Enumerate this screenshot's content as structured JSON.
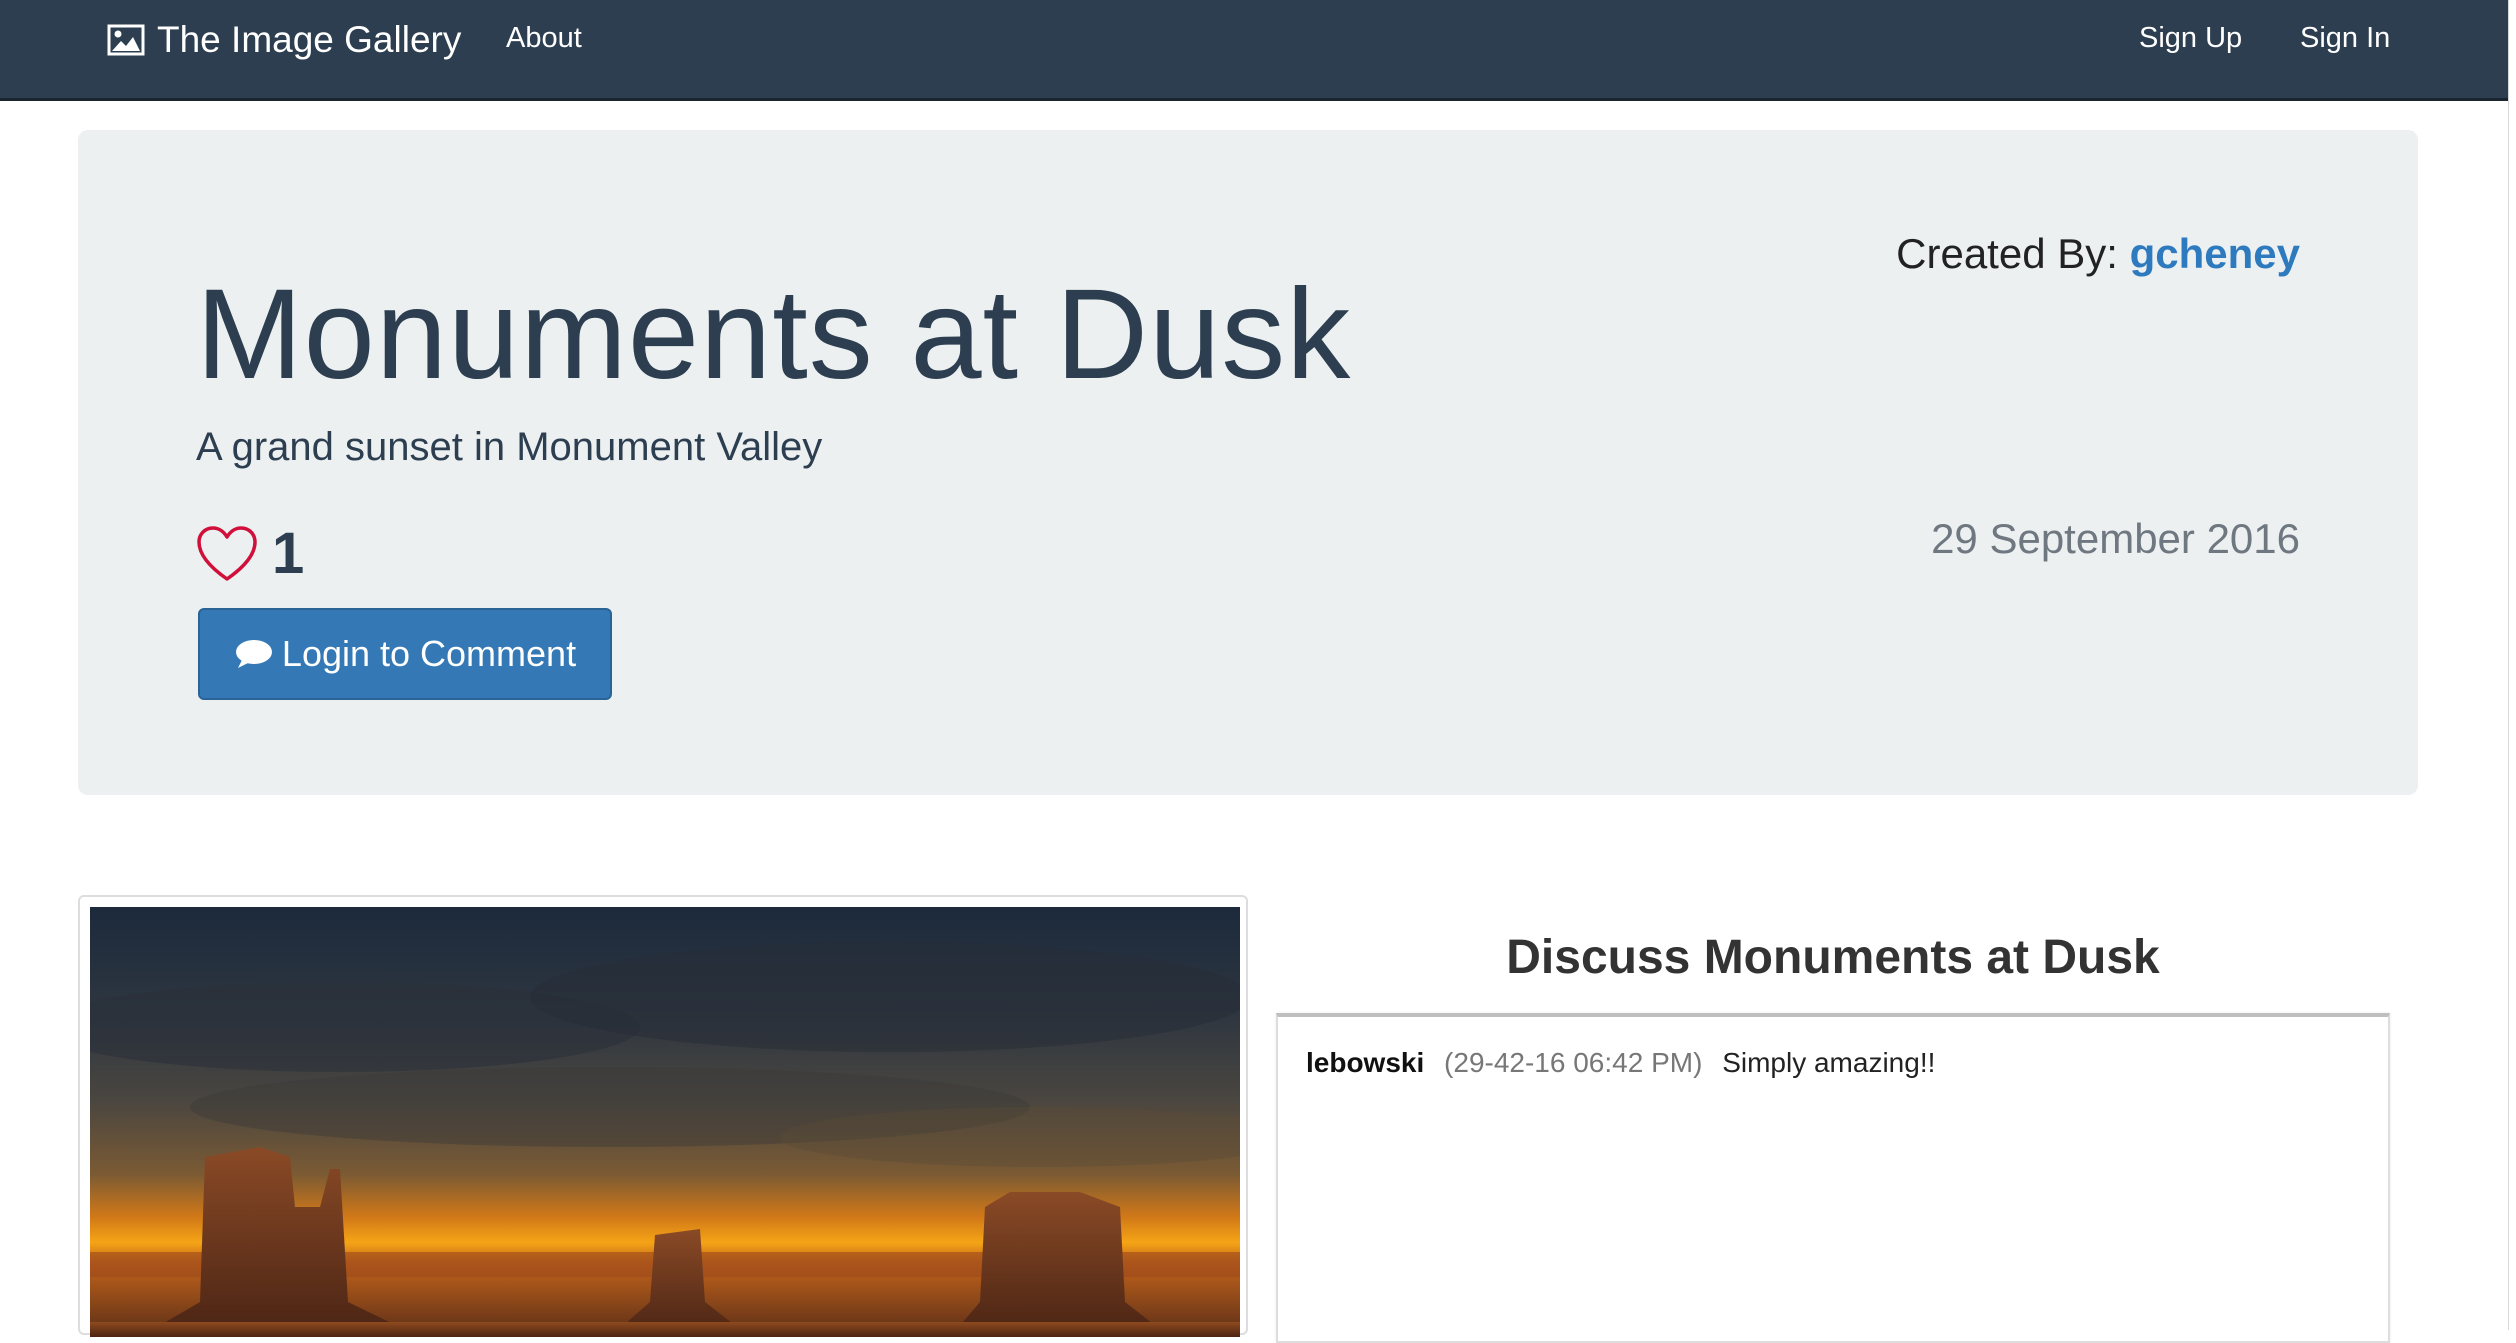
{
  "navbar": {
    "brand_icon": "image-icon",
    "brand": "The Image Gallery",
    "about": "About",
    "sign_up": "Sign Up",
    "sign_in": "Sign In",
    "background_color": "#2c3e50"
  },
  "jumbotron": {
    "title": "Monuments at Dusk",
    "subtitle": "A grand sunset in Monument Valley",
    "created_by_label": "Created By:",
    "created_by_user": "gcheney",
    "date": "29 September 2016",
    "like_icon": "heart-outline-icon",
    "like_color": "#d0103a",
    "likes": "1",
    "comment_button_icon": "comment-icon",
    "comment_button": "Login to Comment",
    "button_color": "#3479b5"
  },
  "image": {
    "content": "photo-monument-valley-sunset"
  },
  "discussion": {
    "title": "Discuss Monuments at Dusk",
    "comments": [
      {
        "user": "lebowski",
        "time": "(29-42-16 06:42 PM)",
        "text": "Simply amazing!!"
      }
    ]
  }
}
